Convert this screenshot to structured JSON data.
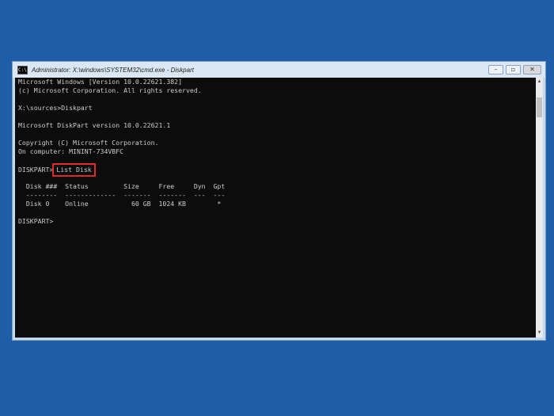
{
  "window": {
    "title": "Administrator: X:\\windows\\SYSTEM32\\cmd.exe - Diskpart",
    "icon_label": "C:\\",
    "buttons": {
      "minimize_glyph": "–",
      "maximize_glyph": "▫",
      "close_glyph": "✕"
    }
  },
  "console": {
    "lines": [
      "Microsoft Windows [Version 10.0.22621.382]",
      "(c) Microsoft Corporation. All rights reserved.",
      "",
      "X:\\sources>Diskpart",
      "",
      "Microsoft DiskPart version 10.0.22621.1",
      "",
      "Copyright (C) Microsoft Corporation.",
      "On computer: MININT-734VBFC"
    ],
    "prompt": "DISKPART>",
    "command": "List Disk",
    "table": {
      "header": "  Disk ###  Status         Size     Free     Dyn  Gpt",
      "separator": "  --------  -------------  -------  -------  ---  ---",
      "rows": [
        "  Disk 0    Online           60 GB  1024 KB        *"
      ]
    },
    "final_prompt": "DISKPART>"
  },
  "colors": {
    "desktop": "#1f5da8",
    "console_bg": "#0c0c0c",
    "console_text": "#cccccc",
    "highlight_box": "#e02a2a"
  }
}
